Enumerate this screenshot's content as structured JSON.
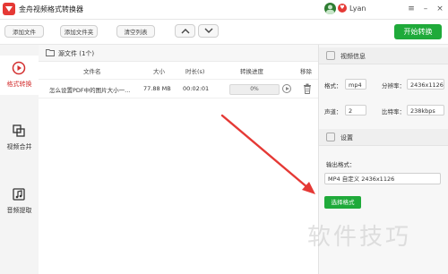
{
  "titlebar": {
    "app_title": "金舟视频格式转换器",
    "username": "Lyan",
    "vip_badge": "♥",
    "controls": [
      "≡",
      "–",
      "×"
    ]
  },
  "toolbar": {
    "add_file": "添加文件",
    "add_folder": "添加文件夹",
    "clear_list": "清空列表",
    "start": "开始转换"
  },
  "sidebar": {
    "items": [
      {
        "label": "格式转换",
        "icon": "play-circle-icon",
        "active": true
      },
      {
        "label": "视频合并",
        "icon": "merge-icon",
        "active": false
      },
      {
        "label": "音频提取",
        "icon": "music-icon",
        "active": false
      }
    ]
  },
  "file_list": {
    "title": "源文件 (1个)",
    "columns": [
      "文件名",
      "大小",
      "时长(s)",
      "转换进度",
      "移除"
    ],
    "rows": [
      {
        "name": "怎么设置PDF中的图片大小一...",
        "size": "77.88 MB",
        "duration": "00:02:01",
        "progress": "0%",
        "progress_fraction": 0
      }
    ]
  },
  "video_info": {
    "title": "视频信息",
    "format_label": "格式：",
    "format_value": "mp4",
    "resolution_label": "分辨率：",
    "resolution_value": "2436x1126",
    "channel_label": "声道：",
    "channel_value": "2",
    "bitrate_label": "比特率：",
    "bitrate_value": "238kbps"
  },
  "settings": {
    "title": "设置",
    "output_label": "输出格式：",
    "output_value": "MP4 自定义 2436x1126",
    "choose_button": "选择格式"
  },
  "watermark": "软件技巧",
  "colors": {
    "accent_green": "#1faa3a",
    "active_red": "#d32f2f",
    "annotation_arrow": "#e53935"
  }
}
